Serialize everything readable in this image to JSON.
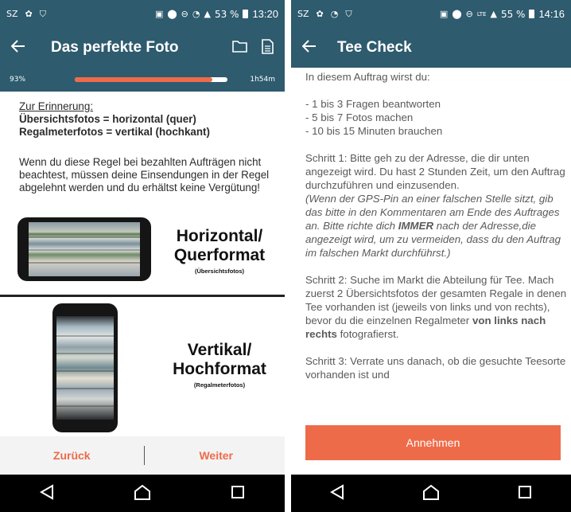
{
  "left": {
    "status": {
      "carrier": "SZ",
      "battery": "53 %",
      "time": "13:20"
    },
    "appbar": {
      "title": "Das perfekte Foto"
    },
    "progress": {
      "percent_label": "93%",
      "fill_fraction": 0.9,
      "time_left": "1h54m"
    },
    "reminder": {
      "title": "Zur Erinnerung:",
      "line1": "Übersichtsfotos = horizontal (quer)",
      "line2": "Regalmeterfotos = vertikal (hochkant)",
      "rule": "Wenn du diese Regel bei bezahlten Aufträgen nicht beachtest, müssen deine Einsendungen in der Regel abgelehnt werden und du erhältst keine Vergütung!"
    },
    "formats": {
      "horizontal": {
        "title_line1": "Horizontal/",
        "title_line2": "Querformat",
        "sub": "(Übersichtsfotos)"
      },
      "vertical": {
        "title_line1": "Vertikal/",
        "title_line2": "Hochformat",
        "sub": "(Regalmeterfotos)"
      }
    },
    "actions": {
      "back": "Zurück",
      "next": "Weiter"
    }
  },
  "right": {
    "status": {
      "carrier": "SZ",
      "network": "LTE",
      "battery": "55 %",
      "time": "14:16"
    },
    "appbar": {
      "title": "Tee Check"
    },
    "intro": "In diesem Auftrag wirst du:",
    "bullets": [
      "- 1 bis 3 Fragen beantworten",
      "- 5 bis 7 Fotos machen",
      "- 10 bis 15 Minuten brauchen"
    ],
    "step1": "Schritt 1: Bitte geh zu der Adresse, die dir unten angezeigt wird. Du hast 2 Stunden Zeit, um den Auftrag durchzuführen und einzusenden.",
    "step1_note_a": "(Wenn der GPS-Pin an einer falschen Stelle sitzt, gib das bitte in den Kommentaren am Ende des Auftrages an. Bitte richte dich ",
    "step1_note_bold": "IMMER",
    "step1_note_b": " nach der Adresse,die angezeigt wird, um zu vermeiden, dass du den Auftrag im falschen Markt durchführst.)",
    "step2_a": "Schritt 2: Suche im Markt die Abteilung für Tee. Mach zuerst 2 Übersichtsfotos der gesamten Regale in denen Tee vorhanden ist (jeweils von links und von rechts), bevor du die einzelnen Regalmeter ",
    "step2_bold": "von links nach rechts",
    "step2_b": " fotografierst.",
    "step3": "Schritt 3: Verrate uns danach, ob die gesuchte Teesorte vorhanden ist und",
    "accept_button": "Annehmen"
  },
  "colors": {
    "appbar": "#2e5b6e",
    "accent": "#ee6b49",
    "navbar": "#000000"
  },
  "icons": [
    "back-arrow-icon",
    "folder-icon",
    "document-icon",
    "nav-back-icon",
    "nav-home-icon",
    "nav-recents-icon"
  ]
}
